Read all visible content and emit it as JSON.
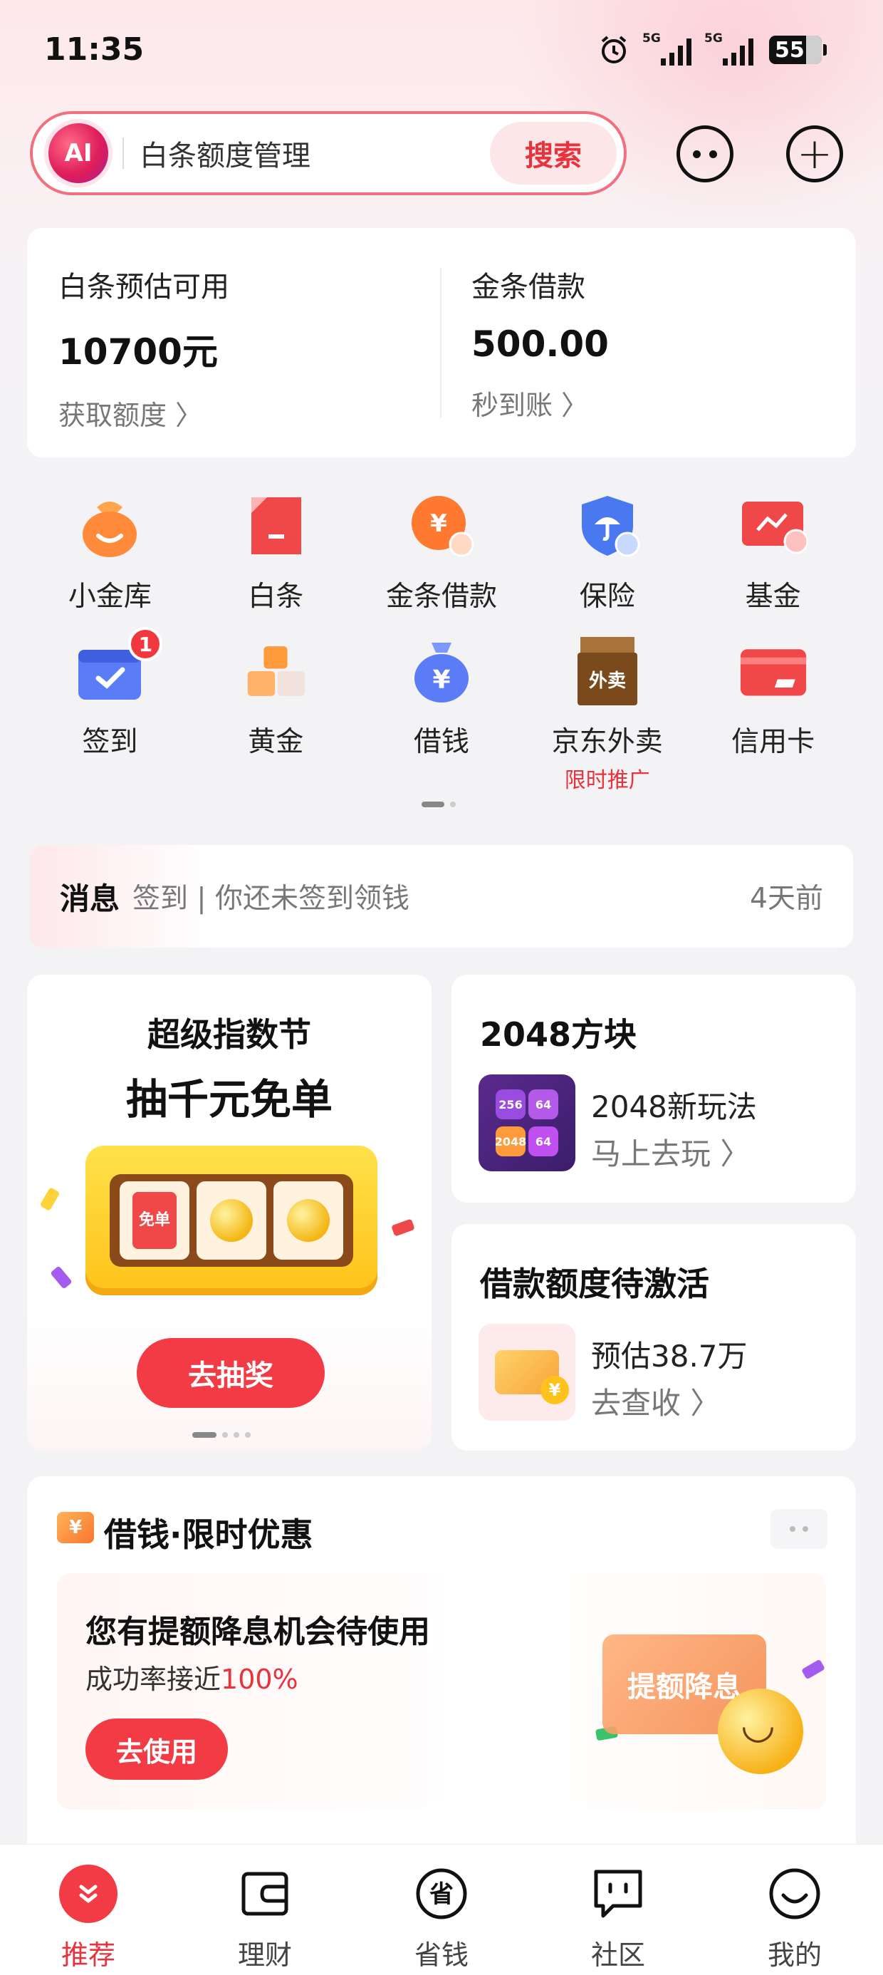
{
  "status_bar": {
    "time": "11:35",
    "network_1": "5G",
    "network_2": "5G",
    "battery": "55"
  },
  "search": {
    "ai_label": "AI",
    "query": "白条额度管理",
    "button": "搜索"
  },
  "credit": {
    "left": {
      "label": "白条预估可用",
      "value": "10700元",
      "link": "获取额度 〉"
    },
    "right": {
      "label": "金条借款",
      "value": "500.00",
      "link": "秒到账 〉"
    }
  },
  "services": [
    {
      "label": "小金库",
      "icon": "piggy-bag-icon"
    },
    {
      "label": "白条",
      "icon": "document-icon"
    },
    {
      "label": "金条借款",
      "icon": "yuan-coin-icon"
    },
    {
      "label": "保险",
      "icon": "umbrella-shield-icon"
    },
    {
      "label": "基金",
      "icon": "chart-card-icon"
    },
    {
      "label": "签到",
      "icon": "calendar-check-icon",
      "badge": "1"
    },
    {
      "label": "黄金",
      "icon": "gold-bars-icon"
    },
    {
      "label": "借钱",
      "icon": "money-bag-icon"
    },
    {
      "label": "京东外卖",
      "icon": "takeout-bag-icon",
      "sub": "限时推广",
      "art": "外卖"
    },
    {
      "label": "信用卡",
      "icon": "credit-card-icon"
    }
  ],
  "message": {
    "title": "消息",
    "text": "签到 | 你还未签到领钱",
    "time": "4天前"
  },
  "promo": {
    "title": "超级指数节",
    "subtitle": "抽千元免单",
    "slot_free": "免单",
    "button": "去抽奖"
  },
  "game_card": {
    "title": "2048方块",
    "line1": "2048新玩法",
    "line2": "马上去玩 〉",
    "tiles": [
      "256",
      "64",
      "2048",
      "64"
    ]
  },
  "loan_card": {
    "title": "借款额度待激活",
    "line1": "预估38.7万",
    "line2": "去查收 〉"
  },
  "offer": {
    "heading": "借钱·限时优惠",
    "icon_char": "¥",
    "title": "您有提额降息机会待使用",
    "sub_prefix": "成功率接近",
    "sub_rate": "100%",
    "button": "去使用",
    "art_label": "提额降息"
  },
  "tabs": [
    {
      "label": "推荐",
      "icon": "home-chevrons-icon",
      "active": true
    },
    {
      "label": "理财",
      "icon": "wallet-icon"
    },
    {
      "label": "省钱",
      "icon": "save-money-icon"
    },
    {
      "label": "社区",
      "icon": "chat-bubble-icon"
    },
    {
      "label": "我的",
      "icon": "smiley-icon"
    }
  ],
  "colors": {
    "accent": "#f23b44",
    "accent_text": "#e8323c",
    "background": "#f3f3f6"
  }
}
